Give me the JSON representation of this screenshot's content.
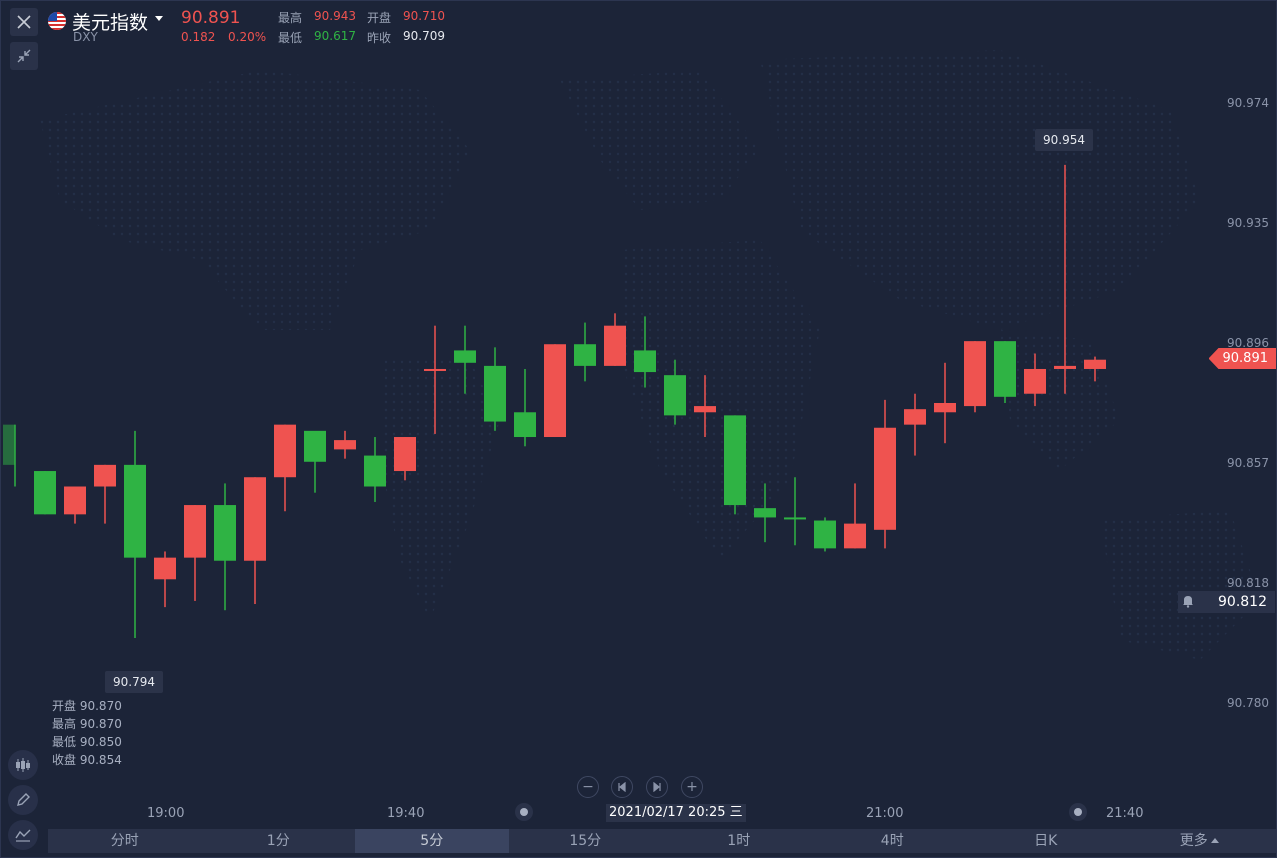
{
  "header": {
    "name": "美元指数",
    "code": "DXY",
    "price": "90.891",
    "change": "0.182",
    "change_pct": "0.20%",
    "stats": {
      "high_label": "最高",
      "high": "90.943",
      "open_label": "开盘",
      "open": "90.710",
      "low_label": "最低",
      "low": "90.617",
      "prev_close_label": "昨收",
      "prev_close": "90.709"
    }
  },
  "ohlc_info": [
    {
      "label": "开盘",
      "value": "90.870"
    },
    {
      "label": "最高",
      "value": "90.870"
    },
    {
      "label": "最低",
      "value": "90.850"
    },
    {
      "label": "收盘",
      "value": "90.854"
    }
  ],
  "callouts": {
    "max": "90.954",
    "min": "90.794"
  },
  "price_tag": "90.891",
  "alert_price": "90.812",
  "cursor_time": "2021/02/17 20:25 三",
  "time_labels": [
    "19:00",
    "19:40",
    "21:00",
    "21:40"
  ],
  "tabs": [
    {
      "label": "分时",
      "active": false
    },
    {
      "label": "1分",
      "active": false
    },
    {
      "label": "5分",
      "active": true
    },
    {
      "label": "15分",
      "active": false
    },
    {
      "label": "1时",
      "active": false
    },
    {
      "label": "4时",
      "active": false
    },
    {
      "label": "日K",
      "active": false
    },
    {
      "label": "更多",
      "active": false
    }
  ],
  "icons": [
    "close-icon",
    "shrink-icon",
    "candlestick-icon",
    "pencil-icon",
    "indicator-icon",
    "bell-icon",
    "zoom-out-icon",
    "prev-icon",
    "next-icon",
    "zoom-in-icon",
    "us-flag-icon",
    "dropdown-caret-icon"
  ],
  "colors": {
    "up": "#ef5350",
    "down": "#2fb344",
    "background": "#1c2438"
  },
  "chart_data": {
    "type": "candlestick",
    "interval": "5分",
    "yaxis_ticks": [
      "90.974",
      "90.935",
      "90.896",
      "90.857",
      "90.818",
      "90.780"
    ],
    "ylim": [
      90.76,
      90.99
    ],
    "candles": [
      {
        "o": 90.87,
        "h": 90.87,
        "c": 90.857,
        "l": 90.85,
        "dir": "down",
        "partial": true
      },
      {
        "o": 90.855,
        "h": 90.855,
        "c": 90.841,
        "l": 90.841,
        "dir": "down"
      },
      {
        "o": 90.841,
        "h": 90.85,
        "c": 90.85,
        "l": 90.838,
        "dir": "up"
      },
      {
        "o": 90.85,
        "h": 90.857,
        "c": 90.857,
        "l": 90.838,
        "dir": "up"
      },
      {
        "o": 90.857,
        "h": 90.868,
        "c": 90.827,
        "l": 90.801,
        "dir": "down"
      },
      {
        "o": 90.82,
        "h": 90.829,
        "c": 90.827,
        "l": 90.811,
        "dir": "up"
      },
      {
        "o": 90.827,
        "h": 90.844,
        "c": 90.844,
        "l": 90.813,
        "dir": "up"
      },
      {
        "o": 90.844,
        "h": 90.851,
        "c": 90.826,
        "l": 90.81,
        "dir": "down"
      },
      {
        "o": 90.826,
        "h": 90.853,
        "c": 90.853,
        "l": 90.812,
        "dir": "up"
      },
      {
        "o": 90.853,
        "h": 90.87,
        "c": 90.87,
        "l": 90.842,
        "dir": "up"
      },
      {
        "o": 90.868,
        "h": 90.867,
        "c": 90.858,
        "l": 90.848,
        "dir": "down"
      },
      {
        "o": 90.862,
        "h": 90.868,
        "c": 90.865,
        "l": 90.859,
        "dir": "up"
      },
      {
        "o": 90.86,
        "h": 90.866,
        "c": 90.85,
        "l": 90.845,
        "dir": "down"
      },
      {
        "o": 90.855,
        "h": 90.866,
        "c": 90.866,
        "l": 90.852,
        "dir": "up"
      },
      {
        "o": 90.888,
        "h": 90.902,
        "c": 90.888,
        "l": 90.867,
        "dir": "up"
      },
      {
        "o": 90.894,
        "h": 90.902,
        "c": 90.89,
        "l": 90.88,
        "dir": "down"
      },
      {
        "o": 90.889,
        "h": 90.895,
        "c": 90.871,
        "l": 90.868,
        "dir": "down"
      },
      {
        "o": 90.874,
        "h": 90.888,
        "c": 90.866,
        "l": 90.863,
        "dir": "down"
      },
      {
        "o": 90.866,
        "h": 90.896,
        "c": 90.896,
        "l": 90.866,
        "dir": "up"
      },
      {
        "o": 90.896,
        "h": 90.903,
        "c": 90.889,
        "l": 90.884,
        "dir": "down"
      },
      {
        "o": 90.889,
        "h": 90.906,
        "c": 90.902,
        "l": 90.889,
        "dir": "up"
      },
      {
        "o": 90.894,
        "h": 90.905,
        "c": 90.887,
        "l": 90.882,
        "dir": "down"
      },
      {
        "o": 90.886,
        "h": 90.891,
        "c": 90.873,
        "l": 90.87,
        "dir": "down"
      },
      {
        "o": 90.874,
        "h": 90.886,
        "c": 90.876,
        "l": 90.866,
        "dir": "up"
      },
      {
        "o": 90.873,
        "h": 90.873,
        "c": 90.844,
        "l": 90.841,
        "dir": "down"
      },
      {
        "o": 90.843,
        "h": 90.851,
        "c": 90.84,
        "l": 90.832,
        "dir": "down"
      },
      {
        "o": 90.84,
        "h": 90.853,
        "c": 90.84,
        "l": 90.831,
        "dir": "down"
      },
      {
        "o": 90.839,
        "h": 90.84,
        "c": 90.83,
        "l": 90.829,
        "dir": "down"
      },
      {
        "o": 90.83,
        "h": 90.851,
        "c": 90.838,
        "l": 90.83,
        "dir": "up"
      },
      {
        "o": 90.836,
        "h": 90.878,
        "c": 90.869,
        "l": 90.83,
        "dir": "up"
      },
      {
        "o": 90.87,
        "h": 90.88,
        "c": 90.875,
        "l": 90.86,
        "dir": "up"
      },
      {
        "o": 90.874,
        "h": 90.89,
        "c": 90.877,
        "l": 90.864,
        "dir": "up"
      },
      {
        "o": 90.876,
        "h": 90.897,
        "c": 90.897,
        "l": 90.874,
        "dir": "up"
      },
      {
        "o": 90.897,
        "h": 90.897,
        "c": 90.879,
        "l": 90.877,
        "dir": "down"
      },
      {
        "o": 90.88,
        "h": 90.893,
        "c": 90.888,
        "l": 90.876,
        "dir": "up"
      },
      {
        "o": 90.888,
        "h": 90.954,
        "c": 90.889,
        "l": 90.88,
        "dir": "up"
      },
      {
        "o": 90.888,
        "h": 90.892,
        "c": 90.891,
        "l": 90.884,
        "dir": "up"
      }
    ]
  }
}
